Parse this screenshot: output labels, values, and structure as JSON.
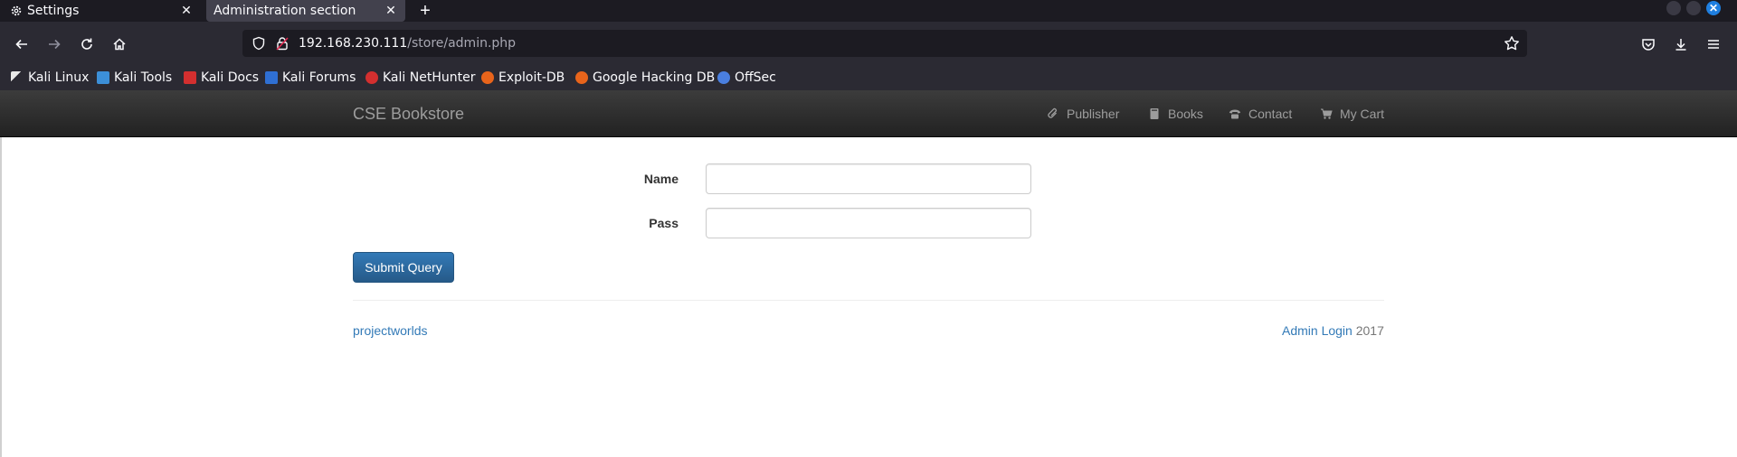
{
  "browser": {
    "tabs": [
      {
        "title": "Settings",
        "icon": "gear-icon"
      },
      {
        "title": "Administration section",
        "icon": ""
      }
    ],
    "url": {
      "host": "192.168.230.111",
      "path": "/store/admin.php"
    },
    "bookmarks": [
      {
        "label": "Kali Linux",
        "icon": "kali-dragon-icon",
        "color": "#e8e8e8"
      },
      {
        "label": "Kali Tools",
        "icon": "kali-tools-icon",
        "color": "#3c8fd8"
      },
      {
        "label": "Kali Docs",
        "icon": "kali-docs-icon",
        "color": "#d32f2f"
      },
      {
        "label": "Kali Forums",
        "icon": "kali-forums-icon",
        "color": "#2f6fd3"
      },
      {
        "label": "Kali NetHunter",
        "icon": "kali-nethunter-icon",
        "color": "#d32f2f"
      },
      {
        "label": "Exploit-DB",
        "icon": "exploit-db-icon",
        "color": "#e8641b"
      },
      {
        "label": "Google Hacking DB",
        "icon": "ghdb-icon",
        "color": "#e8641b"
      },
      {
        "label": "OffSec",
        "icon": "offsec-icon",
        "color": "#4a7fe0"
      }
    ]
  },
  "site": {
    "brand": "CSE Bookstore",
    "nav": [
      {
        "label": "Publisher",
        "icon": "paperclip-icon"
      },
      {
        "label": "Books",
        "icon": "book-icon"
      },
      {
        "label": "Contact",
        "icon": "phone-icon"
      },
      {
        "label": "My Cart",
        "icon": "cart-icon"
      }
    ]
  },
  "form": {
    "name_label": "Name",
    "name_value": "",
    "pass_label": "Pass",
    "pass_value": "",
    "submit_label": "Submit Query"
  },
  "footer": {
    "left_link": "projectworlds",
    "admin_link": "Admin Login",
    "year": "2017"
  },
  "colors": {
    "link": "#337ab7",
    "button": "#337ab7",
    "navbar": "#222222"
  }
}
